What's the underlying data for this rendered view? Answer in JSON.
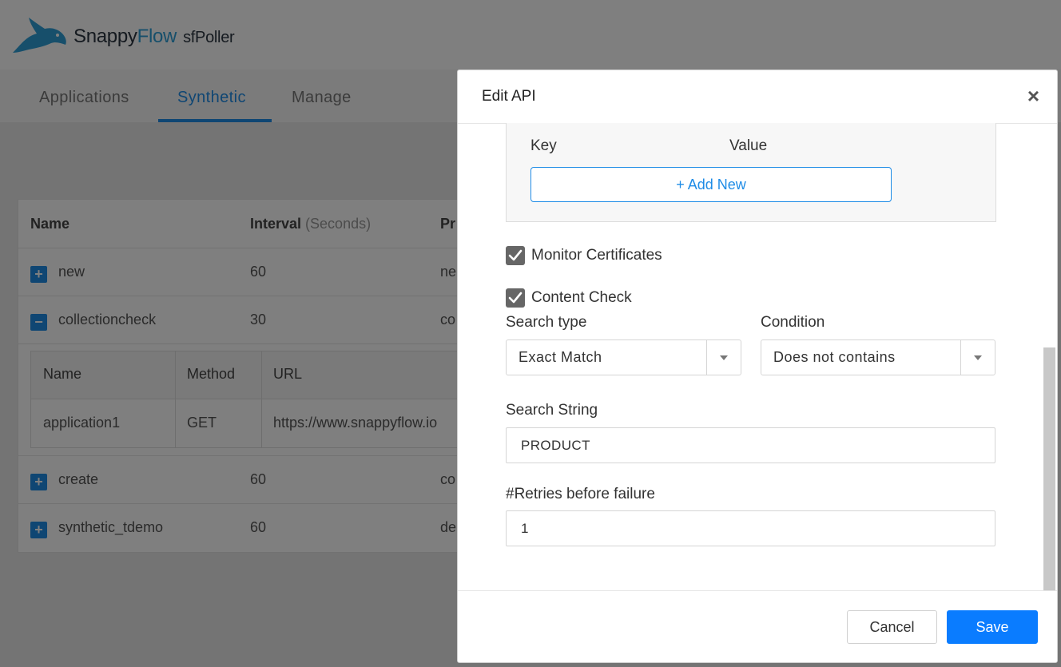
{
  "header": {
    "brand_part1": "Snappy",
    "brand_part2": "Flow",
    "product": "sfPoller"
  },
  "tabs": [
    {
      "label": "Applications"
    },
    {
      "label": "Synthetic",
      "active": true
    },
    {
      "label": "Manage"
    }
  ],
  "table": {
    "columns": {
      "name": "Name",
      "interval": "Interval",
      "interval_unit": "(Seconds)",
      "protocol": "Pr"
    },
    "rows": [
      {
        "expander": "+",
        "name": "new",
        "interval": "60",
        "protocol": "ne"
      },
      {
        "expander": "−",
        "name": "collectioncheck",
        "interval": "30",
        "protocol": "co"
      },
      {
        "expander": "+",
        "name": "create",
        "interval": "60",
        "protocol": "co"
      },
      {
        "expander": "+",
        "name": "synthetic_tdemo",
        "interval": "60",
        "protocol": "de"
      }
    ],
    "subtable": {
      "columns": {
        "name": "Name",
        "method": "Method",
        "url": "URL"
      },
      "row": {
        "name": "application1",
        "method": "GET",
        "url": "https://www.snappyflow.io"
      }
    }
  },
  "modal": {
    "title": "Edit API",
    "close_symbol": "×",
    "kv": {
      "key_label": "Key",
      "value_label": "Value",
      "add_label": "+ Add New"
    },
    "monitor_certificates": {
      "label": "Monitor Certificates",
      "checked": true
    },
    "content_check": {
      "label": "Content Check",
      "checked": true
    },
    "search_type": {
      "label": "Search type",
      "value": "Exact Match"
    },
    "condition": {
      "label": "Condition",
      "value": "Does not contains"
    },
    "search_string": {
      "label": "Search String",
      "value": "PRODUCT"
    },
    "retries": {
      "label": "#Retries before failure",
      "value": "1"
    },
    "cancel_label": "Cancel",
    "save_label": "Save"
  },
  "colors": {
    "accent": "#1f8ce6",
    "save_button": "#0a7cff",
    "checkbox": "#666666",
    "overlay": "rgba(0,0,0,0.5)"
  }
}
